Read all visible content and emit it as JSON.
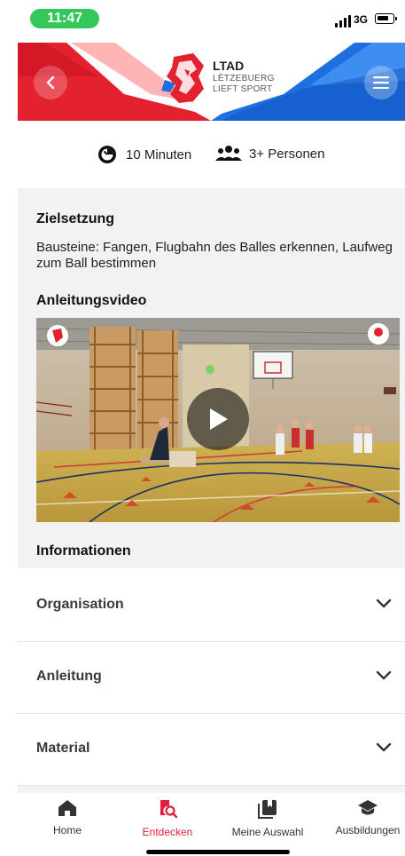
{
  "status_bar": {
    "time": "11:47",
    "network": "3G"
  },
  "header": {
    "logo_title": "LTAD",
    "logo_sub1": "LËTZEBUERG",
    "logo_sub2": "LIEFT SPORT",
    "back_icon": "chevron-left-icon",
    "menu_icon": "hamburger-menu-icon",
    "colors": {
      "red": "#e4222f",
      "blue": "#1e6fe0"
    }
  },
  "meta": {
    "duration": "10 Minuten",
    "persons": "3+ Personen"
  },
  "goal": {
    "heading": "Zielsetzung",
    "text": "Bausteine: Fangen, Flugbahn des Balles erkennen, Laufweg zum Ball bestimmen"
  },
  "video": {
    "heading": "Anleitungsvideo",
    "play_icon": "play-icon"
  },
  "info": {
    "heading": "Informationen",
    "sections": [
      {
        "label": "Organisation"
      },
      {
        "label": "Anleitung"
      },
      {
        "label": "Material"
      }
    ]
  },
  "tabbar": {
    "accent": "#e11f3a",
    "tabs": [
      {
        "label": "Home",
        "icon": "home-icon",
        "active": false
      },
      {
        "label": "Entdecken",
        "icon": "discover-icon",
        "active": true
      },
      {
        "label": "Meine Auswahl",
        "icon": "bookmark-collection-icon",
        "active": false
      },
      {
        "label": "Ausbildungen",
        "icon": "graduation-cap-icon",
        "active": false
      }
    ]
  }
}
